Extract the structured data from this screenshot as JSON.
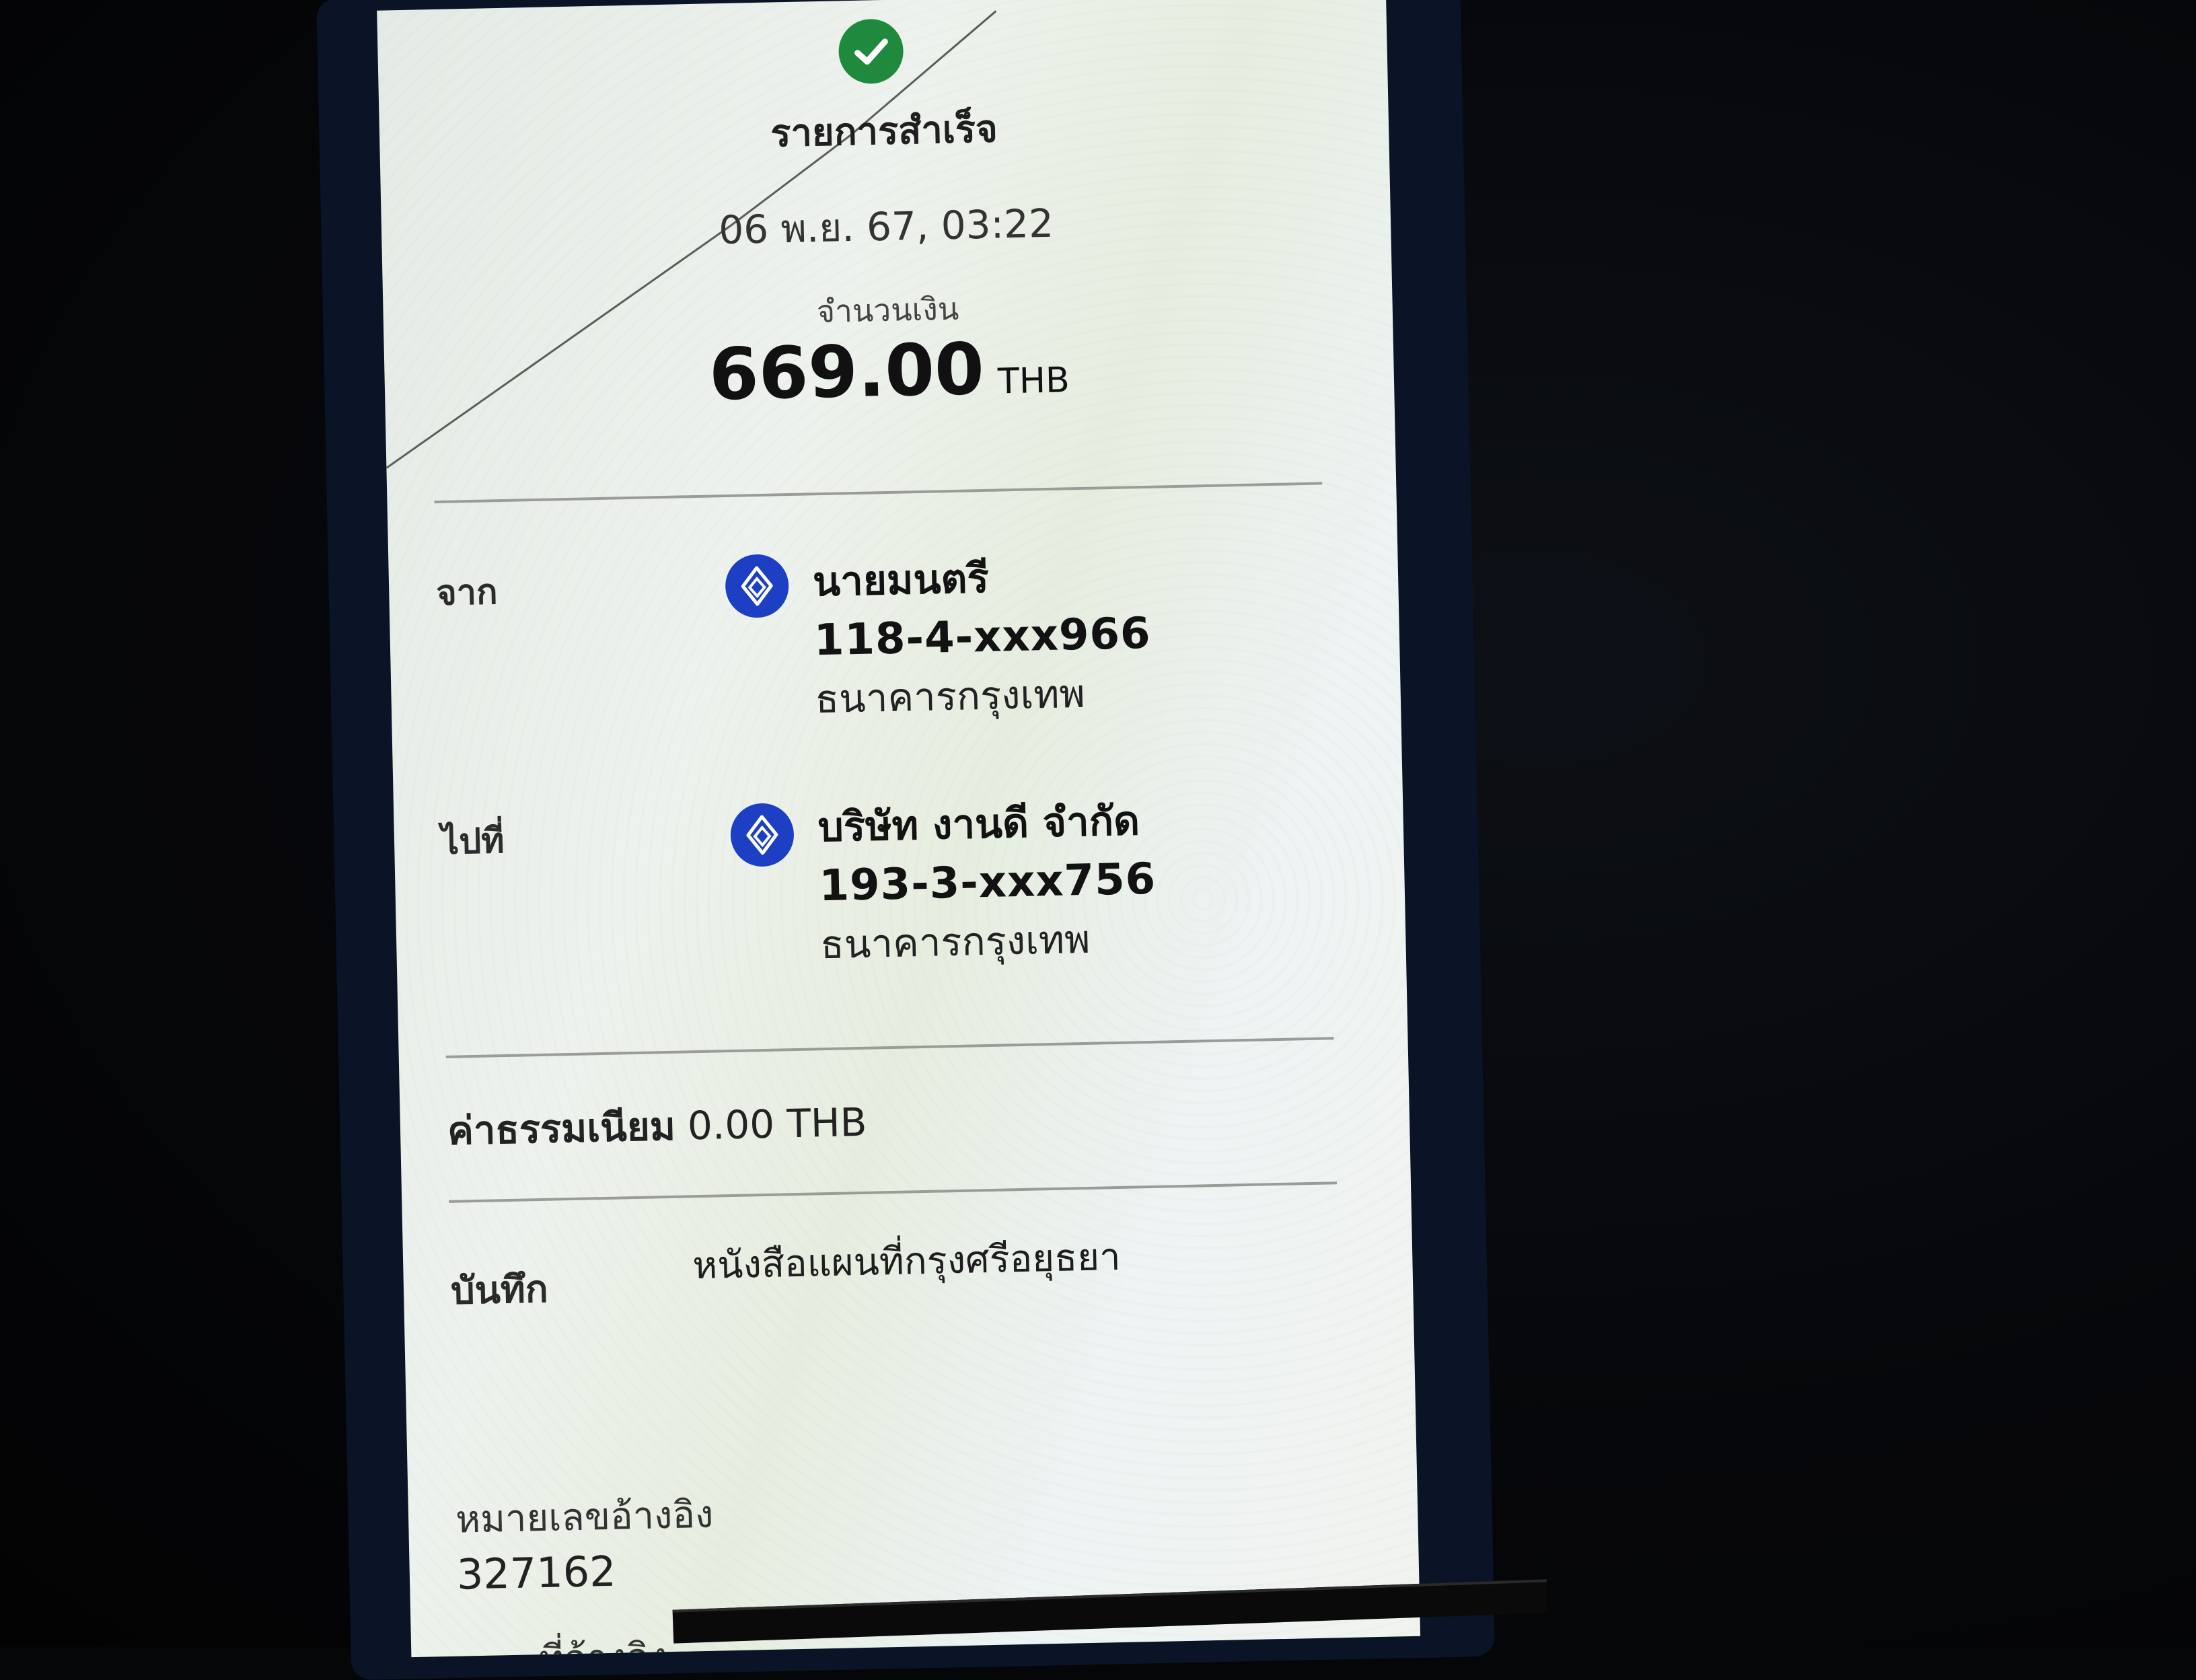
{
  "status": {
    "icon": "checkmark-icon",
    "title": "รายการสำเร็จ",
    "color": "#1f8a3e"
  },
  "transaction": {
    "datetime": "06 พ.ย. 67, 03:22",
    "amount_label": "จำนวนเงิน",
    "amount_value": "669.00",
    "amount_currency": "THB"
  },
  "from": {
    "label": "จาก",
    "icon": "bangkok-bank-icon",
    "name": "นายมนตรี",
    "account": "118-4-xxx966",
    "bank": "ธนาคารกรุงเทพ"
  },
  "to": {
    "label": "ไปที่",
    "icon": "bangkok-bank-icon",
    "name": "บริษัท งานดี จำกัด",
    "account": "193-3-xxx756",
    "bank": "ธนาคารกรุงเทพ"
  },
  "fee": {
    "label": "ค่าธรรมเนียม",
    "value": "0.00 THB"
  },
  "note": {
    "label": "บันทึก",
    "value": "หนังสือแผนที่กรุงศรีอยุธยา"
  },
  "reference": {
    "label": "หมายเลขอ้างอิง",
    "value": "327162",
    "next_label_partial": "ที่อ้างอิง"
  },
  "colors": {
    "bank_blue": "#1c3fc4",
    "success_green": "#1f8a3e"
  }
}
